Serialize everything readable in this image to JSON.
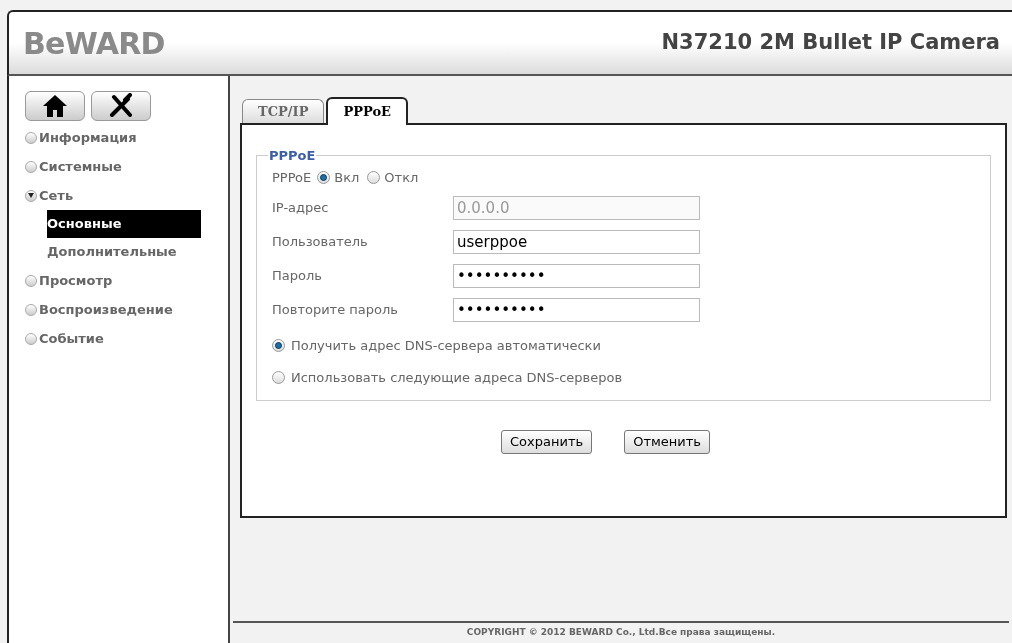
{
  "header": {
    "logo": "BeWARD",
    "title": "N37210 2M Bullet IP Camera"
  },
  "sidebar": {
    "items": [
      {
        "label": "Информация",
        "expanded": false
      },
      {
        "label": "Системные",
        "expanded": false
      },
      {
        "label": "Сеть",
        "expanded": true,
        "children": [
          {
            "label": "Основные",
            "selected": true
          },
          {
            "label": "Дополнительные",
            "selected": false
          }
        ]
      },
      {
        "label": "Просмотр",
        "expanded": false
      },
      {
        "label": "Воспроизведение",
        "expanded": false
      },
      {
        "label": "Событие",
        "expanded": false
      }
    ]
  },
  "tabs": [
    {
      "label": "TCP/IP",
      "selected": false
    },
    {
      "label": "PPPoE",
      "selected": true
    }
  ],
  "group": {
    "legend": "PPPoE",
    "pppoe": {
      "label": "PPPoE",
      "options": [
        {
          "label": "Вкл",
          "selected": true
        },
        {
          "label": "Откл",
          "selected": false
        }
      ]
    },
    "fields": [
      {
        "label": "IP-адрес",
        "value": "0.0.0.0",
        "disabled": true
      },
      {
        "label": "Пользователь",
        "value": "userppoe",
        "disabled": false
      },
      {
        "label": "Пароль",
        "value": "••••••••••",
        "disabled": false
      },
      {
        "label": "Повторите пароль",
        "value": "••••••••••",
        "disabled": false
      }
    ],
    "dns": [
      {
        "label": "Получить адрес DNS-сервера автоматически",
        "selected": true
      },
      {
        "label": "Использовать следующие адреса DNS-серверов",
        "selected": false
      }
    ]
  },
  "buttons": [
    "Сохранить",
    "Отменить"
  ],
  "footer": "COPYRIGHT © 2012 BEWARD Co., Ltd.Все права защищены."
}
